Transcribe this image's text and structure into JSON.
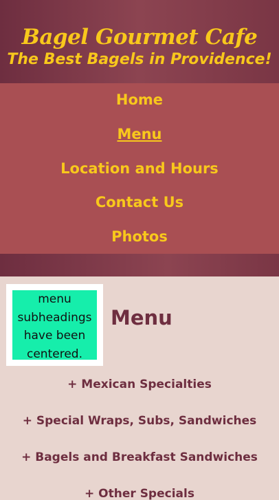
{
  "header": {
    "title": "Bagel Gourmet Cafe",
    "tagline": "The Best Bagels in Providence!"
  },
  "nav": {
    "items": [
      {
        "label": "Home"
      },
      {
        "label": "Menu"
      },
      {
        "label": "Location and Hours"
      },
      {
        "label": "Contact Us"
      },
      {
        "label": "Photos"
      }
    ],
    "active": "Menu"
  },
  "note": {
    "text": "menu subheadings have been centered."
  },
  "main": {
    "heading": "Menu",
    "subheadings": [
      "+ Mexican Specialties",
      "+ Special Wraps, Subs, Sandwiches",
      "+ Bagels and Breakfast Sandwiches",
      "+ Other Specials"
    ]
  },
  "colors": {
    "header_bg": "#7a3645",
    "nav_bg": "#a94f53",
    "accent_yellow": "#f8c81c",
    "page_bg": "#e8d5cf",
    "note_bg": "#16eeab",
    "heading_text": "#6e2e40"
  }
}
